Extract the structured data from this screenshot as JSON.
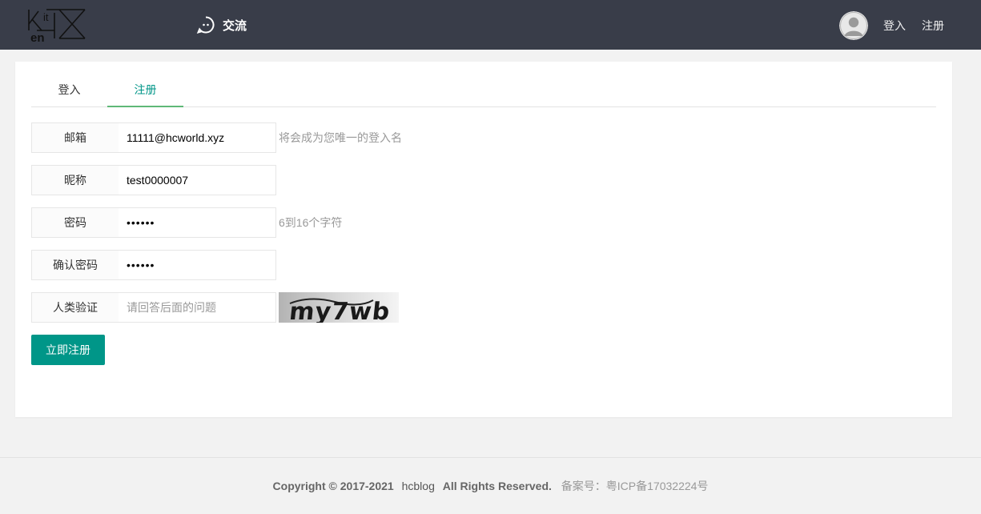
{
  "header": {
    "nav_label": "交流",
    "login_label": "登入",
    "register_label": "注册",
    "bg_color": "#393d49"
  },
  "tabs": [
    {
      "label": "登入",
      "active": false
    },
    {
      "label": "注册",
      "active": true
    }
  ],
  "form": {
    "email": {
      "label": "邮箱",
      "value": "11111@hcworld.xyz",
      "hint": "将会成为您唯一的登入名"
    },
    "nickname": {
      "label": "昵称",
      "value": "test0000007"
    },
    "password": {
      "label": "密码",
      "value": "••••••",
      "hint": "6到16个字符"
    },
    "confirm": {
      "label": "确认密码",
      "value": "••••••"
    },
    "verify": {
      "label": "人类验证",
      "placeholder": "请回答后面的问题",
      "captcha_text": "my7wb"
    },
    "submit_label": "立即注册"
  },
  "footer": {
    "copyright": "Copyright © 2017-2021",
    "site": "hcblog",
    "rights": "All Rights Reserved.",
    "icp_label": "备案号：",
    "icp_number": "粤ICP备17032224号"
  },
  "colors": {
    "accent": "#009688",
    "tab_underline": "#5fb878"
  }
}
